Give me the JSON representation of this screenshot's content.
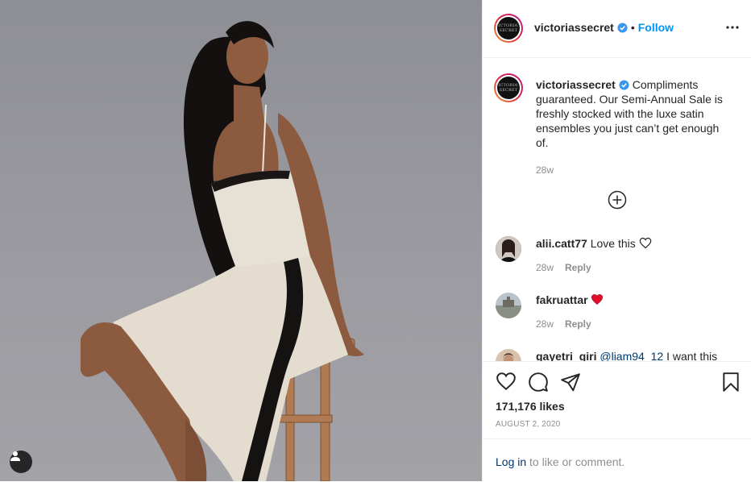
{
  "post": {
    "author": "victoriassecret",
    "avatar_text": "VICTORIA'S SECRET",
    "follow_label": "Follow",
    "dot": "•",
    "caption": "Compliments guaranteed. Our Semi-Annual Sale is freshly stocked with the luxe satin ensembles you just can’t get enough of.",
    "caption_age": "28w",
    "likes": "171,176 likes",
    "date": "AUGUST 2, 2020"
  },
  "comments": [
    {
      "user": "alii.catt77",
      "text": "Love this",
      "trailing_icon": "heart-outline-icon",
      "age": "28w",
      "reply": "Reply"
    },
    {
      "user": "fakruattar",
      "text": "",
      "trailing_icon": "red-heart-icon",
      "age": "28w",
      "reply": "Reply"
    },
    {
      "user": "gayetri_giri",
      "mention": "@liam94_12",
      "text": "I want this",
      "age": "",
      "reply": ""
    }
  ],
  "footer": {
    "login_link": "Log in",
    "login_rest": " to like or comment."
  },
  "colors": {
    "accent": "#0095f6",
    "text": "#262626",
    "muted": "#8e8e8e",
    "heart": "#ed4956",
    "link": "#00376b"
  }
}
